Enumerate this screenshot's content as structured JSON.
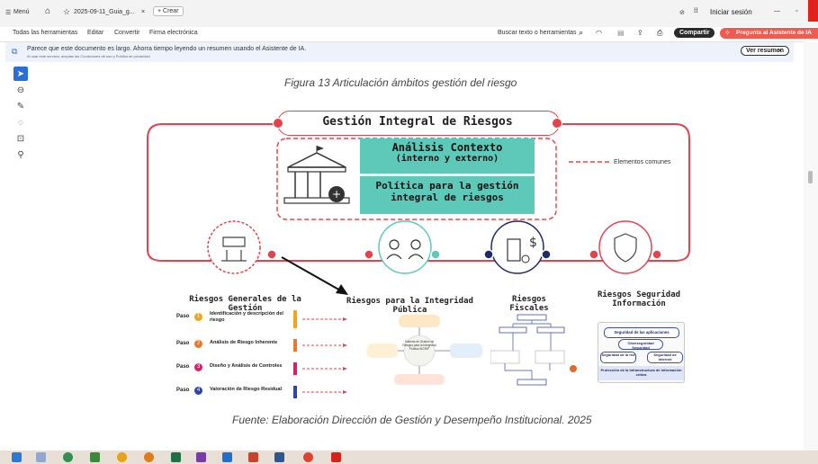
{
  "titlebar": {
    "menu_label": "Menú",
    "home_icon": "home-icon",
    "tab_title": "2025-09-11_Guia_g...",
    "new_tab_label": "+ Crear",
    "signin_label": "Iniciar sesión",
    "minimize_glyph": "—",
    "restore_glyph": "▫"
  },
  "menubar": {
    "items": [
      "Todas las herramientas",
      "Editar",
      "Convertir",
      "Firma electrónica"
    ],
    "search_label": "Buscar texto o herramientas",
    "share_label": "Compartir",
    "ai_label": "Pregunta al Asistente de IA"
  },
  "notification": {
    "message": "Parece que este documento es largo. Ahorra tiempo leyendo un resumen usando el Asistente de IA.",
    "sub": "Al usar este servicio, aceptas las Condiciones de uso y Política de privacidad",
    "view_summary": "Ver resumen",
    "close": "×"
  },
  "document": {
    "figure_caption": "Figura 13 Articulación ámbitos gestión del riesgo",
    "main_title": "Gestión Integral de Riesgos",
    "green1_line1": "Análisis Contexto",
    "green1_line2": "(interno y externo)",
    "green2_line1": "Política para la gestión",
    "green2_line2": "integral de riesgos",
    "legend": "Elementos comunes",
    "categories": [
      "Riesgos Generales de la Gestión",
      "Riesgos para la Integridad Pública",
      "Riesgos Fiscales",
      "Riesgos Seguridad Información"
    ],
    "steps": [
      {
        "label": "Paso",
        "num": "1",
        "text": "Identificación y descripción del riesgo",
        "color": "#f4a31c"
      },
      {
        "label": "Paso",
        "num": "2",
        "text": "Análisis de Riesgo Inherente",
        "color": "#e9782a"
      },
      {
        "label": "Paso",
        "num": "3",
        "text": "Diseño y Análisis de Controles",
        "color": "#d4236a"
      },
      {
        "label": "Paso",
        "num": "4",
        "text": "Valoración de Riesgo Residual",
        "color": "#2d45a8"
      }
    ],
    "integrity_center": "Sistema de Gestión de Riesgos para la Integridad Pública SIGRIP",
    "security_box": {
      "top": "Seguridad de las aplicaciones",
      "mid": "Ciberseguridad Seguridad",
      "left": "Seguridad de la red",
      "right": "Seguridad de Internet",
      "bottom": "Protección de la Infraestructura de Información crítica"
    },
    "source_caption": "Fuente: Elaboración Dirección de Gestión y Desempeño Institucional. 2025"
  },
  "colors": {
    "accent_red": "#e0454f",
    "teal": "#5ec9b9",
    "navy": "#1f2a6b",
    "share_bg": "#2b2b2b",
    "ai_bg": "#f05a4f"
  }
}
